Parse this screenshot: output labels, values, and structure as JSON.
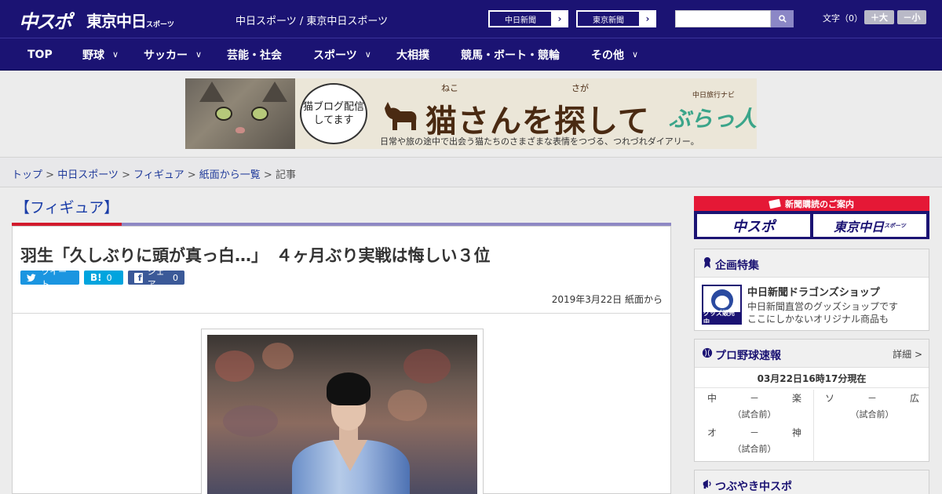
{
  "header": {
    "logo_main": "中スポ",
    "logo_tokyo": "東京中日",
    "logo_tokyo_small": "スポーツ",
    "site_name": "中日スポーツ / 東京中日スポーツ",
    "link_chunichi": "中日新聞",
    "link_tokyo": "東京新聞",
    "font_size_label": "文字（0）",
    "font_bigger": "＋大",
    "font_smaller": "－小"
  },
  "nav": [
    {
      "label": "TOP",
      "chevron": false
    },
    {
      "label": "野球",
      "chevron": true
    },
    {
      "label": "サッカー",
      "chevron": true
    },
    {
      "label": "芸能・社会",
      "chevron": false
    },
    {
      "label": "スポーツ",
      "chevron": true
    },
    {
      "label": "大相撲",
      "chevron": false
    },
    {
      "label": "競馬・ボート・競輪",
      "chevron": false
    },
    {
      "label": "その他",
      "chevron": true
    }
  ],
  "banner": {
    "bubble": "猫ブログ配信してます",
    "ruby1": "ねこ",
    "ruby2": "さが",
    "title": "猫さんを探して",
    "tag": "中日旅行ナビ",
    "brand": "ぶらっ人",
    "sub": "日常や旅の途中で出会う猫たちのさまざまな表情をつづる、つれづれダイアリー。"
  },
  "breadcrumb": {
    "items": [
      "トップ",
      "中日スポーツ",
      "フィギュア",
      "紙面から一覧"
    ],
    "current": "記事"
  },
  "article": {
    "section": "【フィギュア】",
    "headline": "羽生「久しぶりに頭が真っ白…」　４ヶ月ぶり実戦は悔しい３位",
    "tweet": "ツイート",
    "hatena_mark": "B!",
    "hatena_count": "0",
    "fb_share": "シェア",
    "fb_count": "0",
    "date": "2019年3月22日 紙面から"
  },
  "sidebar": {
    "subscribe_head": "新聞購読のご案内",
    "subscribe_a": "中スポ",
    "subscribe_b": "東京中日",
    "subscribe_b_small": "スポーツ",
    "feature_title": "企画特集",
    "shop_label": "グッズ販売中",
    "shop_title": "中日新聞ドラゴンズショップ",
    "shop_desc1": "中日新聞直営のグッズショップです",
    "shop_desc2": "ここにしかないオリジナル商品も",
    "score_title": "プロ野球速報",
    "score_detail": "詳細 >",
    "score_time": "03月22日16時17分現在",
    "games": [
      {
        "home": "中",
        "sep": "－",
        "away": "楽",
        "status": "（試合前）"
      },
      {
        "home": "ソ",
        "sep": "－",
        "away": "広",
        "status": "（試合前）"
      },
      {
        "home": "オ",
        "sep": "－",
        "away": "神",
        "status": "（試合前）"
      }
    ],
    "tweet_title": "つぶやき中スポ"
  },
  "colors": {
    "brand_navy": "#1b1373",
    "accent_red": "#d21b2d",
    "link_blue": "#1f3a9a"
  }
}
